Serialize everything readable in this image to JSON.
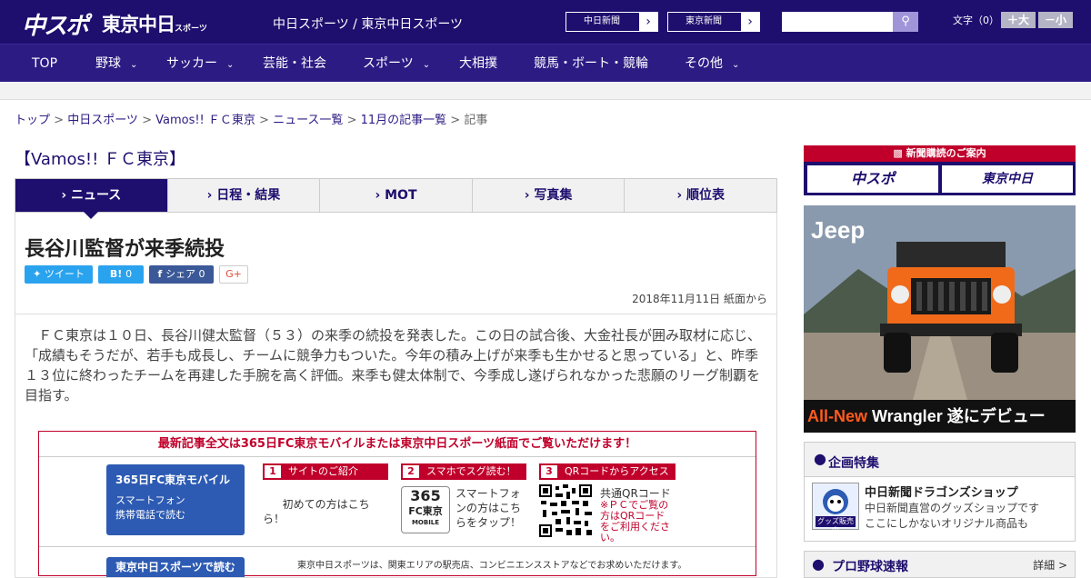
{
  "header": {
    "logo_chuspo": "中スポ",
    "logo_tokyo": "東京中日",
    "logo_tokyo_small": "スポーツ",
    "site_names": "中日スポーツ / 東京中日スポーツ",
    "paper_buttons": [
      "中日新聞",
      "東京新聞"
    ],
    "search_placeholder": "",
    "font_size_label": "文字（0）",
    "font_up": "＋大",
    "font_down": "－小"
  },
  "nav": {
    "items": [
      {
        "label": "TOP",
        "has_menu": false
      },
      {
        "label": "野球",
        "has_menu": true
      },
      {
        "label": "サッカー",
        "has_menu": true
      },
      {
        "label": "芸能・社会",
        "has_menu": false
      },
      {
        "label": "スポーツ",
        "has_menu": true
      },
      {
        "label": "大相撲",
        "has_menu": false
      },
      {
        "label": "競馬・ボート・競輪",
        "has_menu": false
      },
      {
        "label": "その他",
        "has_menu": true
      }
    ]
  },
  "breadcrumb": {
    "items": [
      "トップ",
      "中日スポーツ",
      "Vamos!! ＦＣ東京",
      "ニュース一覧",
      "11月の記事一覧"
    ],
    "current": "記事"
  },
  "section_title": "【Vamos!! ＦＣ東京】",
  "tabs": [
    {
      "label": "› ニュース",
      "active": true
    },
    {
      "label": "› 日程・結果",
      "active": false
    },
    {
      "label": "› MOT",
      "active": false
    },
    {
      "label": "› 写真集",
      "active": false
    },
    {
      "label": "› 順位表",
      "active": false
    }
  ],
  "article": {
    "title": "長谷川監督が来季続投",
    "share": {
      "tweet": "ツイート",
      "hatena_count": "0",
      "facebook": "シェア 0",
      "gplus": "G+"
    },
    "date": "2018年11月11日 紙面から",
    "body": "ＦＣ東京は１０日、長谷川健太監督（５３）の来季の続投を発表した。この日の試合後、大金社長が囲み取材に応じ、「成績もそうだが、若手も成長し、チームに競争力もついた。今年の積み上げが来季も生かせると思っている」と、昨季１３位に終わったチームを再建した手腕を高く評価。来季も健太体制で、今季成し遂げられなかった悲願のリーグ制覇を目指す。"
  },
  "promo": {
    "title": "最新記事全文は365日FC東京モバイルまたは東京中日スポーツ紙面でご覧いただけます！",
    "mobile_title": "365日FC東京モバイル",
    "mobile_sub": "スマートフォン\n携帯電話で読む",
    "steps": [
      {
        "num": "1",
        "label": "サイトのご紹介",
        "text": "初めての方はこちら！"
      },
      {
        "num": "2",
        "label": "スマホでスグ読む！",
        "text": "スマートフォンの方はこちらをタップ！"
      },
      {
        "num": "3",
        "label": "QRコードからアクセス",
        "text": "共通QRコード",
        "note": "※ＰＣでご覧の方はQRコードをご利用ください。"
      }
    ],
    "icon_365": "365",
    "icon_fc": "FC東京",
    "icon_mobile": "MOBILE",
    "tokyo_label": "東京中日スポーツで読む",
    "tokyo_text": "東京中日スポーツは、関東エリアの駅売店、コンビニエンスストアなどでお求めいただけます。"
  },
  "sidebar": {
    "subscription_title": "新聞購読のご案内",
    "sub_buttons": [
      "中スポ",
      "東京中日"
    ],
    "ad": {
      "brand": "Jeep",
      "headline_hl": "All-New",
      "headline": " Wrangler 遂にデビュー"
    },
    "feature_title": "企画特集",
    "shop_name": "中日新聞ドラゴンズショップ",
    "shop_desc": "中日新聞直営のグッズショップです\nここにしかないオリジナル商品も",
    "shop_badge": "グッズ販売中",
    "baseball_title": "プロ野球速報",
    "baseball_more": "詳細 >"
  },
  "colors": {
    "header_bg": "#1e0e6e",
    "nav_bg": "#2d1b84",
    "accent_red": "#c0002b",
    "mobile_blue": "#2d5bb3"
  }
}
